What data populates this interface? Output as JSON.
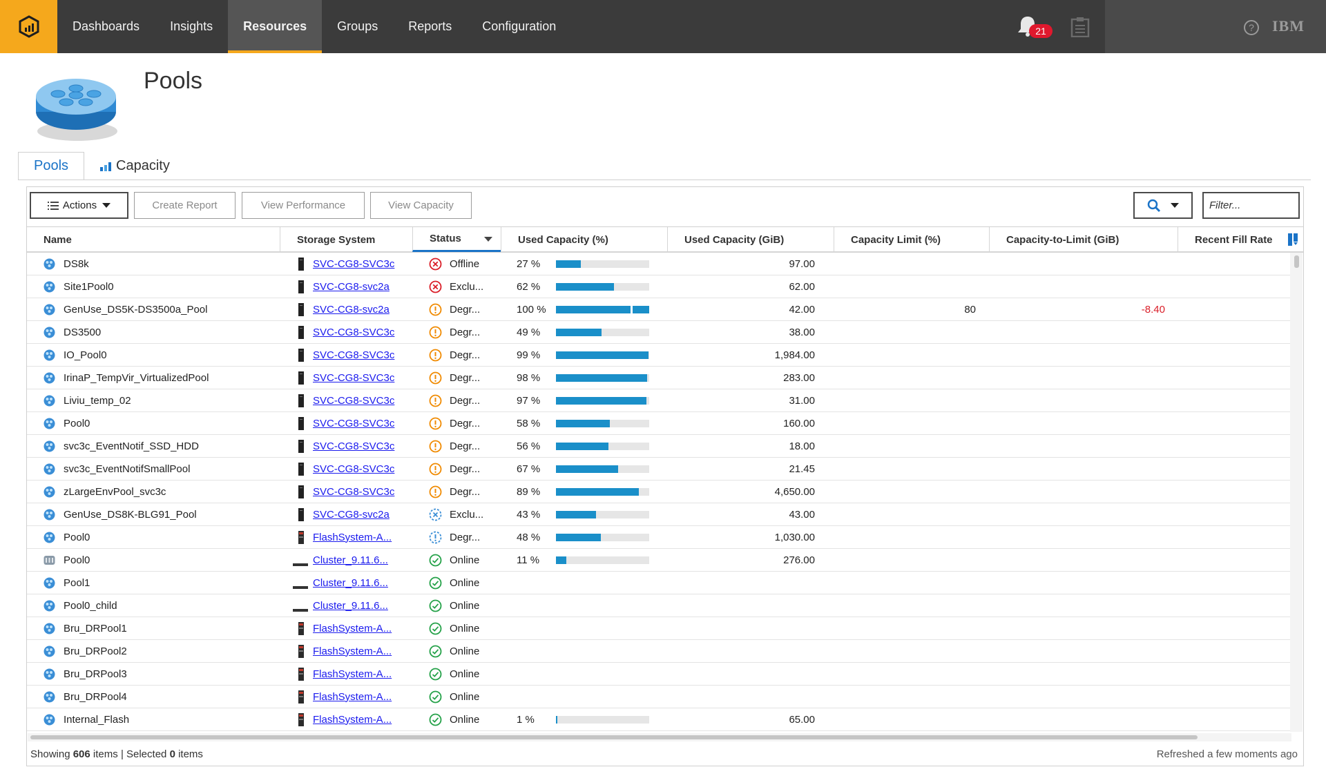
{
  "nav": {
    "items": [
      "Dashboards",
      "Insights",
      "Resources",
      "Groups",
      "Reports",
      "Configuration"
    ],
    "active": "Resources",
    "notification_count": "21",
    "brand": "IBM"
  },
  "page": {
    "title": "Pools"
  },
  "tabs": [
    {
      "label": "Pools"
    },
    {
      "label": "Capacity"
    }
  ],
  "toolbar": {
    "actions_label": "Actions",
    "create_report_label": "Create Report",
    "view_performance_label": "View Performance",
    "view_capacity_label": "View Capacity",
    "filter_placeholder": "Filter..."
  },
  "table": {
    "columns": [
      "Name",
      "Storage System",
      "Status",
      "Used Capacity (%)",
      "Used Capacity (GiB)",
      "Capacity Limit (%)",
      "Capacity-to-Limit (GiB)",
      "Recent Fill Rate"
    ],
    "rows": [
      {
        "name": "DS8k",
        "pool_icon": "pool-icon",
        "system": "SVC-CG8-SVC3c",
        "system_icon": "svc-device-icon",
        "status": "Offline",
        "status_icon": "error-icon",
        "used_pct_label": "27 %",
        "used_pct": 27,
        "used_gib": "97.00",
        "limit_pct": "",
        "to_limit": ""
      },
      {
        "name": "Site1Pool0",
        "pool_icon": "pool-icon",
        "system": "SVC-CG8-svc2a",
        "system_icon": "svc-device-icon",
        "status": "Exclu...",
        "status_icon": "error-icon",
        "used_pct_label": "62 %",
        "used_pct": 62,
        "used_gib": "62.00",
        "limit_pct": "",
        "to_limit": ""
      },
      {
        "name": "GenUse_DS5K-DS3500a_Pool",
        "pool_icon": "pool-icon",
        "system": "SVC-CG8-svc2a",
        "system_icon": "svc-device-icon",
        "status": "Degr...",
        "status_icon": "warning-icon",
        "used_pct_label": "100 %",
        "used_pct": 100,
        "used_gib": "42.00",
        "limit_pct": "80",
        "to_limit": "-8.40",
        "mark": 80
      },
      {
        "name": "DS3500",
        "pool_icon": "pool-icon",
        "system": "SVC-CG8-SVC3c",
        "system_icon": "svc-device-icon",
        "status": "Degr...",
        "status_icon": "warning-icon",
        "used_pct_label": "49 %",
        "used_pct": 49,
        "used_gib": "38.00",
        "limit_pct": "",
        "to_limit": ""
      },
      {
        "name": "IO_Pool0",
        "pool_icon": "pool-icon",
        "system": "SVC-CG8-SVC3c",
        "system_icon": "svc-device-icon",
        "status": "Degr...",
        "status_icon": "warning-icon",
        "used_pct_label": "99 %",
        "used_pct": 99,
        "used_gib": "1,984.00",
        "limit_pct": "",
        "to_limit": ""
      },
      {
        "name": "IrinaP_TempVir_VirtualizedPool",
        "pool_icon": "pool-icon",
        "system": "SVC-CG8-SVC3c",
        "system_icon": "svc-device-icon",
        "status": "Degr...",
        "status_icon": "warning-icon",
        "used_pct_label": "98 %",
        "used_pct": 98,
        "used_gib": "283.00",
        "limit_pct": "",
        "to_limit": ""
      },
      {
        "name": "Liviu_temp_02",
        "pool_icon": "pool-icon",
        "system": "SVC-CG8-SVC3c",
        "system_icon": "svc-device-icon",
        "status": "Degr...",
        "status_icon": "warning-icon",
        "used_pct_label": "97 %",
        "used_pct": 97,
        "used_gib": "31.00",
        "limit_pct": "",
        "to_limit": ""
      },
      {
        "name": "Pool0",
        "pool_icon": "pool-icon",
        "system": "SVC-CG8-SVC3c",
        "system_icon": "svc-device-icon",
        "status": "Degr...",
        "status_icon": "warning-icon",
        "used_pct_label": "58 %",
        "used_pct": 58,
        "used_gib": "160.00",
        "limit_pct": "",
        "to_limit": ""
      },
      {
        "name": "svc3c_EventNotif_SSD_HDD",
        "pool_icon": "pool-icon",
        "system": "SVC-CG8-SVC3c",
        "system_icon": "svc-device-icon",
        "status": "Degr...",
        "status_icon": "warning-icon",
        "used_pct_label": "56 %",
        "used_pct": 56,
        "used_gib": "18.00",
        "limit_pct": "",
        "to_limit": ""
      },
      {
        "name": "svc3c_EventNotifSmallPool",
        "pool_icon": "pool-icon",
        "system": "SVC-CG8-SVC3c",
        "system_icon": "svc-device-icon",
        "status": "Degr...",
        "status_icon": "warning-icon",
        "used_pct_label": "67 %",
        "used_pct": 67,
        "used_gib": "21.45",
        "limit_pct": "",
        "to_limit": ""
      },
      {
        "name": "zLargeEnvPool_svc3c",
        "pool_icon": "pool-icon",
        "system": "SVC-CG8-SVC3c",
        "system_icon": "svc-device-icon",
        "status": "Degr...",
        "status_icon": "warning-icon",
        "used_pct_label": "89 %",
        "used_pct": 89,
        "used_gib": "4,650.00",
        "limit_pct": "",
        "to_limit": ""
      },
      {
        "name": "GenUse_DS8K-BLG91_Pool",
        "pool_icon": "pool-icon",
        "system": "SVC-CG8-svc2a",
        "system_icon": "svc-device-icon",
        "status": "Exclu...",
        "status_icon": "excluded-icon",
        "used_pct_label": "43 %",
        "used_pct": 43,
        "used_gib": "43.00",
        "limit_pct": "",
        "to_limit": ""
      },
      {
        "name": "Pool0",
        "pool_icon": "pool-icon",
        "system": "FlashSystem-A...",
        "system_icon": "flash-device-icon",
        "status": "Degr...",
        "status_icon": "degraded-alt-icon",
        "used_pct_label": "48 %",
        "used_pct": 48,
        "used_gib": "1,030.00",
        "limit_pct": "",
        "to_limit": ""
      },
      {
        "name": "Pool0",
        "pool_icon": "filesystem-pool-icon",
        "system": "Cluster_9.11.6...",
        "system_icon": "cluster-device-icon",
        "status": "Online",
        "status_icon": "online-icon",
        "used_pct_label": "11 %",
        "used_pct": 11,
        "used_gib": "276.00",
        "limit_pct": "",
        "to_limit": ""
      },
      {
        "name": "Pool1",
        "pool_icon": "pool-icon",
        "system": "Cluster_9.11.6...",
        "system_icon": "cluster-device-icon",
        "status": "Online",
        "status_icon": "online-icon",
        "used_pct_label": "",
        "used_pct": null,
        "used_gib": "",
        "limit_pct": "",
        "to_limit": ""
      },
      {
        "name": "Pool0_child",
        "pool_icon": "pool-icon",
        "system": "Cluster_9.11.6...",
        "system_icon": "cluster-device-icon",
        "status": "Online",
        "status_icon": "online-icon",
        "used_pct_label": "",
        "used_pct": null,
        "used_gib": "",
        "limit_pct": "",
        "to_limit": ""
      },
      {
        "name": "Bru_DRPool1",
        "pool_icon": "pool-icon",
        "system": "FlashSystem-A...",
        "system_icon": "flash-device-icon",
        "status": "Online",
        "status_icon": "online-icon",
        "used_pct_label": "",
        "used_pct": null,
        "used_gib": "",
        "limit_pct": "",
        "to_limit": ""
      },
      {
        "name": "Bru_DRPool2",
        "pool_icon": "pool-icon",
        "system": "FlashSystem-A...",
        "system_icon": "flash-device-icon",
        "status": "Online",
        "status_icon": "online-icon",
        "used_pct_label": "",
        "used_pct": null,
        "used_gib": "",
        "limit_pct": "",
        "to_limit": ""
      },
      {
        "name": "Bru_DRPool3",
        "pool_icon": "pool-icon",
        "system": "FlashSystem-A...",
        "system_icon": "flash-device-icon",
        "status": "Online",
        "status_icon": "online-icon",
        "used_pct_label": "",
        "used_pct": null,
        "used_gib": "",
        "limit_pct": "",
        "to_limit": ""
      },
      {
        "name": "Bru_DRPool4",
        "pool_icon": "pool-icon",
        "system": "FlashSystem-A...",
        "system_icon": "flash-device-icon",
        "status": "Online",
        "status_icon": "online-icon",
        "used_pct_label": "",
        "used_pct": null,
        "used_gib": "",
        "limit_pct": "",
        "to_limit": ""
      },
      {
        "name": "Internal_Flash",
        "pool_icon": "pool-icon",
        "system": "FlashSystem-A...",
        "system_icon": "flash-device-icon",
        "status": "Online",
        "status_icon": "online-icon",
        "used_pct_label": "1 %",
        "used_pct": 1,
        "used_gib": "65.00",
        "limit_pct": "",
        "to_limit": ""
      }
    ]
  },
  "footer": {
    "showing_prefix": "Showing",
    "item_count": "606",
    "items_word": "items",
    "selected_prefix": "| Selected",
    "selected_count": "0",
    "refreshed": "Refreshed a few moments ago"
  },
  "colors": {
    "brand_accent": "#f5a81c",
    "link": "#1a1aee",
    "bar": "#1a8fc9",
    "error": "#da1e28",
    "warning": "#f08a00",
    "online": "#24a148",
    "negative_value": "#da1e28"
  }
}
